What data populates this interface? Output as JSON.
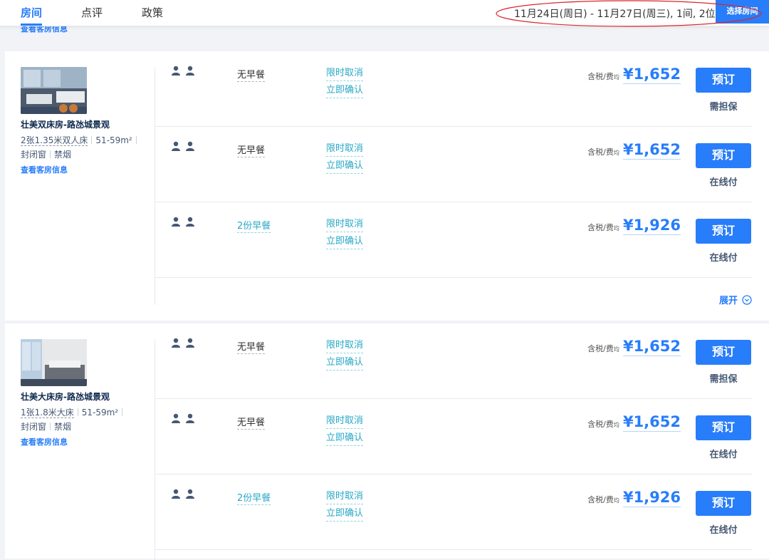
{
  "nav": {
    "tabs": [
      {
        "label": "房间",
        "active": true
      },
      {
        "label": "点评",
        "active": false
      },
      {
        "label": "政策",
        "active": false
      }
    ],
    "date_summary": "11月24日(周日) - 11月27日(周三), 1间, 2位",
    "select_button": "选择房间",
    "peek_link": "查看客房信息"
  },
  "colors": {
    "accent": "#287dfa",
    "policy": "#28a8c6",
    "title": "#0f294d",
    "annotation": "#d9282f"
  },
  "icons": {
    "guest": "person-icon",
    "expand": "chevron-down-circle-icon"
  },
  "rooms": [
    {
      "name": "壮美双床房-路氹城景观",
      "bed": "2张1.35米双人床",
      "area": "51-59m²",
      "window": "封闭窗",
      "smoking": "禁烟",
      "details_link": "查看客房信息",
      "rates": [
        {
          "breakfast": "无早餐",
          "cancel": "限时取消",
          "confirm": "立即确认",
          "tax_label": "含税/费",
          "tax_suffix": "均",
          "price": "¥1,652",
          "book": "预订",
          "pay": "需担保"
        },
        {
          "breakfast": "无早餐",
          "cancel": "限时取消",
          "confirm": "立即确认",
          "tax_label": "含税/费",
          "tax_suffix": "均",
          "price": "¥1,652",
          "book": "预订",
          "pay": "在线付"
        },
        {
          "breakfast": "2份早餐",
          "cancel": "限时取消",
          "confirm": "立即确认",
          "tax_label": "含税/费",
          "tax_suffix": "均",
          "price": "¥1,926",
          "book": "预订",
          "pay": "在线付"
        }
      ],
      "expand_label": "展开"
    },
    {
      "name": "壮美大床房-路氹城景观",
      "bed": "1张1.8米大床",
      "area": "51-59m²",
      "window": "封闭窗",
      "smoking": "禁烟",
      "details_link": "查看客房信息",
      "rates": [
        {
          "breakfast": "无早餐",
          "cancel": "限时取消",
          "confirm": "立即确认",
          "tax_label": "含税/费",
          "tax_suffix": "均",
          "price": "¥1,652",
          "book": "预订",
          "pay": "需担保"
        },
        {
          "breakfast": "无早餐",
          "cancel": "限时取消",
          "confirm": "立即确认",
          "tax_label": "含税/费",
          "tax_suffix": "均",
          "price": "¥1,652",
          "book": "预订",
          "pay": "在线付"
        },
        {
          "breakfast": "2份早餐",
          "cancel": "限时取消",
          "confirm": "立即确认",
          "tax_label": "含税/费",
          "tax_suffix": "均",
          "price": "¥1,926",
          "book": "预订",
          "pay": "在线付"
        }
      ]
    }
  ]
}
